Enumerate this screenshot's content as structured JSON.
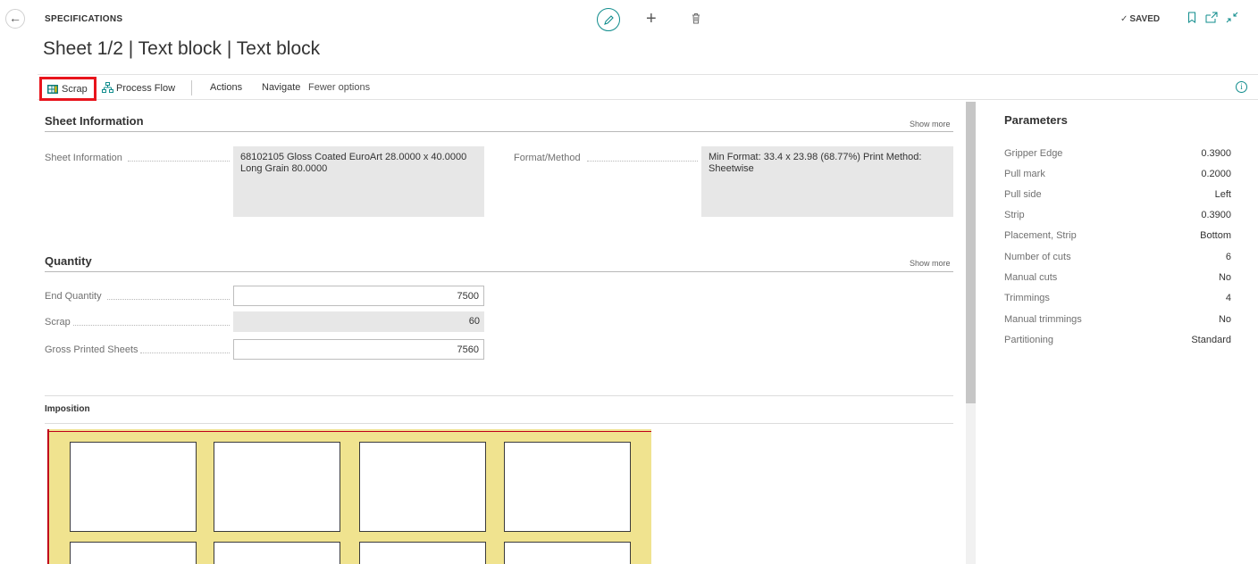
{
  "header": {
    "entity_type": "SPECIFICATIONS",
    "title": "Sheet 1/2 | Text block | Text block",
    "saved_label": "SAVED"
  },
  "actions": {
    "scrap": "Scrap",
    "process_flow": "Process Flow",
    "actions": "Actions",
    "navigate": "Navigate",
    "fewer_options": "Fewer options"
  },
  "sheet_information": {
    "title": "Sheet Information",
    "show_more": "Show more",
    "label_sheet_info": "Sheet Information",
    "value_sheet_info": "68102105 Gloss Coated EuroArt 28.0000 x 40.0000 Long Grain 80.0000",
    "label_format": "Format/Method",
    "value_format": "Min Format: 33.4 x 23.98 (68.77%) Print Method: Sheetwise"
  },
  "quantity": {
    "title": "Quantity",
    "show_more": "Show more",
    "end_quantity_label": "End Quantity",
    "end_quantity_value": "7500",
    "scrap_label": "Scrap",
    "scrap_value": "60",
    "gross_label": "Gross Printed Sheets",
    "gross_value": "7560"
  },
  "imposition": {
    "title": "Imposition"
  },
  "parameters": {
    "title": "Parameters",
    "rows": [
      {
        "label": "Gripper Edge",
        "value": "0.3900"
      },
      {
        "label": "Pull mark",
        "value": "0.2000"
      },
      {
        "label": "Pull side",
        "value": "Left"
      },
      {
        "label": "Strip",
        "value": "0.3900"
      },
      {
        "label": "Placement, Strip",
        "value": "Bottom"
      },
      {
        "label": "Number of cuts",
        "value": "6"
      },
      {
        "label": "Manual cuts",
        "value": "No"
      },
      {
        "label": "Trimmings",
        "value": "4"
      },
      {
        "label": "Manual trimmings",
        "value": "No"
      },
      {
        "label": "Partitioning",
        "value": "Standard"
      }
    ]
  },
  "colors": {
    "accent": "#0f8c8c",
    "highlight_border": "#e8141c",
    "imposition_fill": "#f0e38f",
    "imposition_line": "#c0001a"
  },
  "icons": {
    "back": "arrow-left-icon",
    "edit": "pencil-icon",
    "new": "plus-icon",
    "delete": "trash-icon",
    "saved": "check-icon",
    "bookmark": "bookmark-icon",
    "open_new": "open-in-new-window-icon",
    "collapse": "collapse-icon",
    "scrap": "scrap-grid-icon",
    "process_flow": "hierarchy-icon",
    "info": "info-icon"
  }
}
